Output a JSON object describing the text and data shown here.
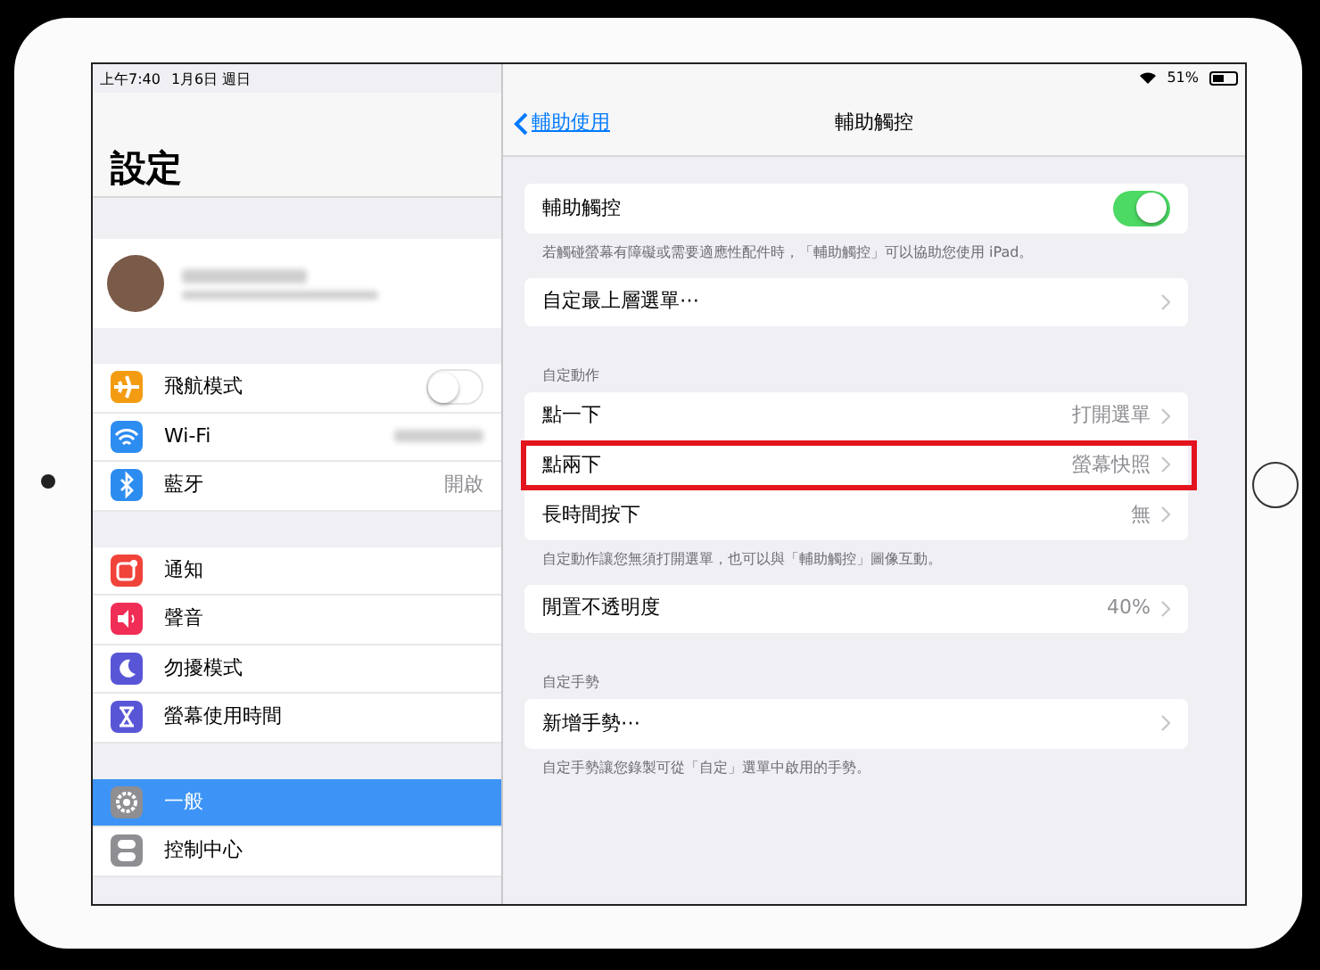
{
  "status_bar": {
    "time": "上午7:40",
    "date": "1月6日 週日",
    "battery": "51%"
  },
  "sidebar": {
    "title": "設定",
    "groups": [
      [
        {
          "label": "飛航模式",
          "kind": "toggle",
          "on": false,
          "color": "#f39c12",
          "selected": false
        },
        {
          "label": "Wi-Fi",
          "kind": "blurred",
          "color": "#2d8cf0",
          "selected": false
        },
        {
          "label": "藍牙",
          "kind": "value",
          "value": "開啟",
          "color": "#2d8cf0",
          "selected": false
        }
      ],
      [
        {
          "label": "通知",
          "kind": "plain",
          "color": "#f0433a",
          "selected": false
        },
        {
          "label": "聲音",
          "kind": "plain",
          "color": "#f02d55",
          "selected": false
        },
        {
          "label": "勿擾模式",
          "kind": "plain",
          "color": "#5856d6",
          "selected": false
        },
        {
          "label": "螢幕使用時間",
          "kind": "plain",
          "color": "#5856d6",
          "selected": false
        }
      ],
      [
        {
          "label": "一般",
          "kind": "plain",
          "color": "#8e8e93",
          "selected": true
        },
        {
          "label": "控制中心",
          "kind": "plain",
          "color": "#8e8e93",
          "selected": false
        }
      ]
    ]
  },
  "detail": {
    "back": "輔助使用",
    "title": "輔助觸控",
    "groups": [
      {
        "rows": [
          {
            "label": "輔助觸控",
            "kind": "toggle",
            "on": true,
            "highlighted": false
          }
        ],
        "footer": "若觸碰螢幕有障礙或需要適應性配件時，「輔助觸控」可以協助您使用 iPad。"
      },
      {
        "rows": [
          {
            "label": "自定最上層選單⋯",
            "kind": "link",
            "highlighted": false
          }
        ]
      },
      {
        "header": "自定動作",
        "rows": [
          {
            "label": "點一下",
            "kind": "link",
            "value": "打開選單",
            "highlighted": false
          },
          {
            "label": "點兩下",
            "kind": "link",
            "value": "螢幕快照",
            "highlighted": true
          },
          {
            "label": "長時間按下",
            "kind": "link",
            "value": "無",
            "highlighted": false
          }
        ],
        "footer": "自定動作讓您無須打開選單，也可以與「輔助觸控」圖像互動。"
      },
      {
        "rows": [
          {
            "label": "閒置不透明度",
            "kind": "link",
            "value": "40%",
            "highlighted": false
          }
        ]
      },
      {
        "header": "自定手勢",
        "rows": [
          {
            "label": "新增手勢⋯",
            "kind": "link",
            "highlighted": false
          }
        ],
        "footer": "自定手勢讓您錄製可從「自定」選單中啟用的手勢。"
      }
    ]
  }
}
